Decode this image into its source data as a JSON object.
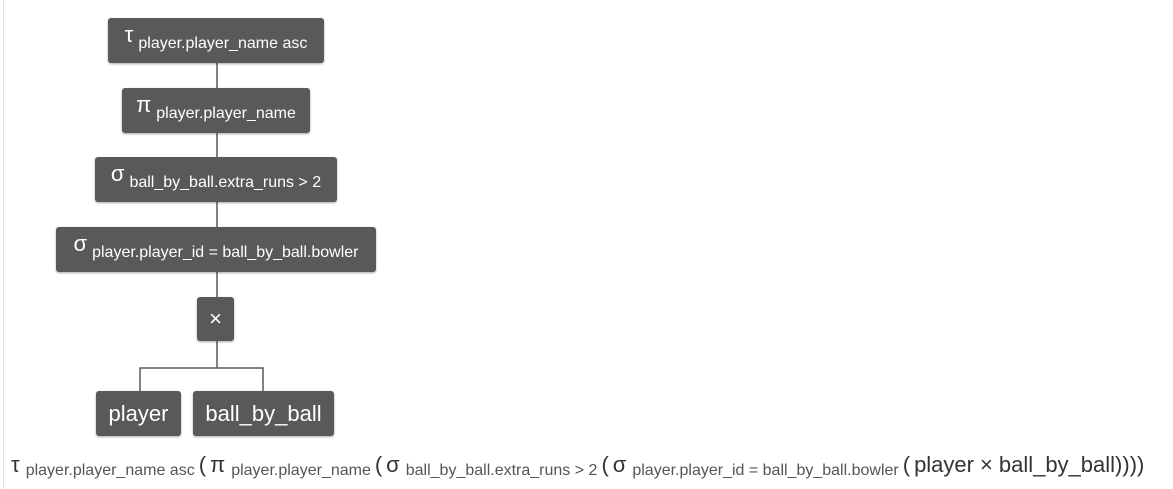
{
  "tree": {
    "sort": {
      "symbol": "τ",
      "condition": "player.player_name asc"
    },
    "project": {
      "symbol": "π",
      "condition": "player.player_name"
    },
    "select_extra": {
      "symbol": "σ",
      "condition": "ball_by_ball.extra_runs > 2"
    },
    "select_join": {
      "symbol": "σ",
      "condition": "player.player_id = ball_by_ball.bowler"
    },
    "cross": {
      "symbol": "×"
    },
    "relations": {
      "left": "player",
      "right": "ball_by_ball"
    }
  },
  "expression": {
    "sort_symbol": "τ",
    "sort_cond": "player.player_name asc",
    "project_symbol": "π",
    "project_cond": "player.player_name",
    "select1_symbol": "σ",
    "select1_cond": "ball_by_ball.extra_runs > 2",
    "select2_symbol": "σ",
    "select2_cond": "player.player_id = ball_by_ball.bowler",
    "open_paren": "(",
    "left_relation": "player",
    "cross_symbol": "×",
    "right_relation": "ball_by_ball",
    "closing": "))))"
  },
  "colors": {
    "node_background": "#595959",
    "node_text": "#ffffff",
    "edge": "#595959",
    "expression_text": "#333333"
  }
}
